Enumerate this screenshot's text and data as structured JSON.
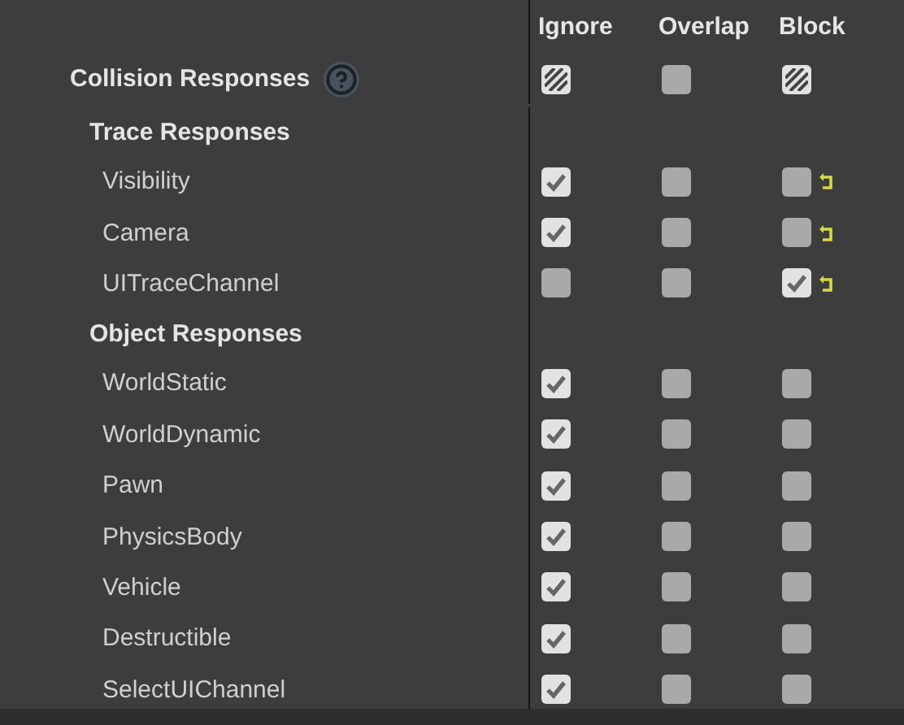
{
  "columns": [
    "Ignore",
    "Overlap",
    "Block"
  ],
  "master": {
    "label": "Collision Responses",
    "responses": [
      {
        "mixed": true
      },
      {
        "mixed": false
      },
      {
        "mixed": true
      }
    ]
  },
  "groups": [
    {
      "title": "Trace Responses",
      "channels": [
        {
          "name": "Visibility",
          "responses": [
            {
              "checked": true
            },
            {
              "checked": false
            },
            {
              "checked": false
            }
          ],
          "modified": true
        },
        {
          "name": "Camera",
          "responses": [
            {
              "checked": true
            },
            {
              "checked": false
            },
            {
              "checked": false
            }
          ],
          "modified": true
        },
        {
          "name": "UITraceChannel",
          "responses": [
            {
              "checked": false
            },
            {
              "checked": false
            },
            {
              "checked": true
            }
          ],
          "modified": true
        }
      ]
    },
    {
      "title": "Object Responses",
      "channels": [
        {
          "name": "WorldStatic",
          "responses": [
            {
              "checked": true
            },
            {
              "checked": false
            },
            {
              "checked": false
            }
          ],
          "modified": false
        },
        {
          "name": "WorldDynamic",
          "responses": [
            {
              "checked": true
            },
            {
              "checked": false
            },
            {
              "checked": false
            }
          ],
          "modified": false
        },
        {
          "name": "Pawn",
          "responses": [
            {
              "checked": true
            },
            {
              "checked": false
            },
            {
              "checked": false
            }
          ],
          "modified": false
        },
        {
          "name": "PhysicsBody",
          "responses": [
            {
              "checked": true
            },
            {
              "checked": false
            },
            {
              "checked": false
            }
          ],
          "modified": false
        },
        {
          "name": "Vehicle",
          "responses": [
            {
              "checked": true
            },
            {
              "checked": false
            },
            {
              "checked": false
            }
          ],
          "modified": false
        },
        {
          "name": "Destructible",
          "responses": [
            {
              "checked": true
            },
            {
              "checked": false
            },
            {
              "checked": false
            }
          ],
          "modified": false
        },
        {
          "name": "SelectUIChannel",
          "responses": [
            {
              "checked": true
            },
            {
              "checked": false
            },
            {
              "checked": false
            }
          ],
          "modified": false
        }
      ]
    }
  ]
}
